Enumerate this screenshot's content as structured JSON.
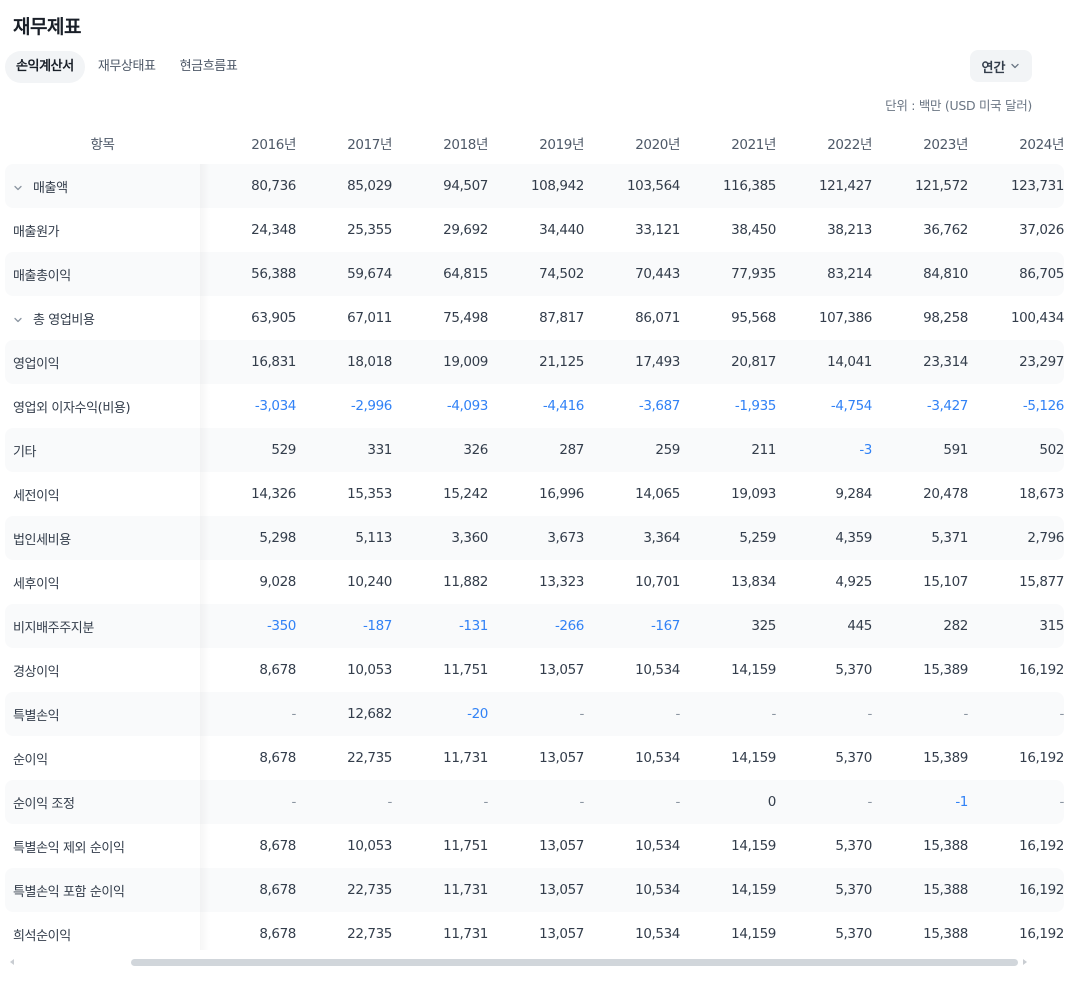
{
  "page": {
    "title": "재무제표"
  },
  "tabs": [
    {
      "label": "손익계산서",
      "active": true
    },
    {
      "label": "재무상태표",
      "active": false
    },
    {
      "label": "현금흐름표",
      "active": false
    }
  ],
  "period": {
    "label": "연간",
    "icon": "chevron-down-icon"
  },
  "unit": "단위 : 백만 (USD 미국 달러)",
  "table": {
    "label_header": "항목",
    "years": [
      "2016년",
      "2017년",
      "2018년",
      "2019년",
      "2020년",
      "2021년",
      "2022년",
      "2023년",
      "2024년"
    ],
    "rows": [
      {
        "label": "매출액",
        "expandable": true,
        "values": [
          "80,736",
          "85,029",
          "94,507",
          "108,942",
          "103,564",
          "116,385",
          "121,427",
          "121,572",
          "123,731"
        ]
      },
      {
        "label": "매출원가",
        "expandable": false,
        "values": [
          "24,348",
          "25,355",
          "29,692",
          "34,440",
          "33,121",
          "38,450",
          "38,213",
          "36,762",
          "37,026"
        ]
      },
      {
        "label": "매출총이익",
        "expandable": false,
        "values": [
          "56,388",
          "59,674",
          "64,815",
          "74,502",
          "70,443",
          "77,935",
          "83,214",
          "84,810",
          "86,705"
        ]
      },
      {
        "label": "총 영업비용",
        "expandable": true,
        "values": [
          "63,905",
          "67,011",
          "75,498",
          "87,817",
          "86,071",
          "95,568",
          "107,386",
          "98,258",
          "100,434"
        ]
      },
      {
        "label": "영업이익",
        "expandable": false,
        "values": [
          "16,831",
          "18,018",
          "19,009",
          "21,125",
          "17,493",
          "20,817",
          "14,041",
          "23,314",
          "23,297"
        ]
      },
      {
        "label": "영업외 이자수익(비용)",
        "expandable": false,
        "values": [
          "-3,034",
          "-2,996",
          "-4,093",
          "-4,416",
          "-3,687",
          "-1,935",
          "-4,754",
          "-3,427",
          "-5,126"
        ]
      },
      {
        "label": "기타",
        "expandable": false,
        "values": [
          "529",
          "331",
          "326",
          "287",
          "259",
          "211",
          "-3",
          "591",
          "502"
        ]
      },
      {
        "label": "세전이익",
        "expandable": false,
        "values": [
          "14,326",
          "15,353",
          "15,242",
          "16,996",
          "14,065",
          "19,093",
          "9,284",
          "20,478",
          "18,673"
        ]
      },
      {
        "label": "법인세비용",
        "expandable": false,
        "values": [
          "5,298",
          "5,113",
          "3,360",
          "3,673",
          "3,364",
          "5,259",
          "4,359",
          "5,371",
          "2,796"
        ]
      },
      {
        "label": "세후이익",
        "expandable": false,
        "values": [
          "9,028",
          "10,240",
          "11,882",
          "13,323",
          "10,701",
          "13,834",
          "4,925",
          "15,107",
          "15,877"
        ]
      },
      {
        "label": "비지배주주지분",
        "expandable": false,
        "values": [
          "-350",
          "-187",
          "-131",
          "-266",
          "-167",
          "325",
          "445",
          "282",
          "315"
        ]
      },
      {
        "label": "경상이익",
        "expandable": false,
        "values": [
          "8,678",
          "10,053",
          "11,751",
          "13,057",
          "10,534",
          "14,159",
          "5,370",
          "15,389",
          "16,192"
        ]
      },
      {
        "label": "특별손익",
        "expandable": false,
        "values": [
          "-",
          "12,682",
          "-20",
          "-",
          "-",
          "-",
          "-",
          "-",
          "-"
        ]
      },
      {
        "label": "순이익",
        "expandable": false,
        "values": [
          "8,678",
          "22,735",
          "11,731",
          "13,057",
          "10,534",
          "14,159",
          "5,370",
          "15,389",
          "16,192"
        ]
      },
      {
        "label": "순이익 조정",
        "expandable": false,
        "values": [
          "-",
          "-",
          "-",
          "-",
          "-",
          "0",
          "-",
          "-1",
          "-"
        ]
      },
      {
        "label": "특별손익 제외 순이익",
        "expandable": false,
        "values": [
          "8,678",
          "10,053",
          "11,751",
          "13,057",
          "10,534",
          "14,159",
          "5,370",
          "15,388",
          "16,192"
        ]
      },
      {
        "label": "특별손익 포함 순이익",
        "expandable": false,
        "values": [
          "8,678",
          "22,735",
          "11,731",
          "13,057",
          "10,534",
          "14,159",
          "5,370",
          "15,388",
          "16,192"
        ]
      },
      {
        "label": "희석순이익",
        "expandable": false,
        "values": [
          "8,678",
          "22,735",
          "11,731",
          "13,057",
          "10,534",
          "14,159",
          "5,370",
          "15,388",
          "16,192"
        ]
      }
    ]
  },
  "colors": {
    "negative": "#3182f6",
    "row_shade": "#f9fafb",
    "tab_active_bg": "#f2f4f6"
  }
}
